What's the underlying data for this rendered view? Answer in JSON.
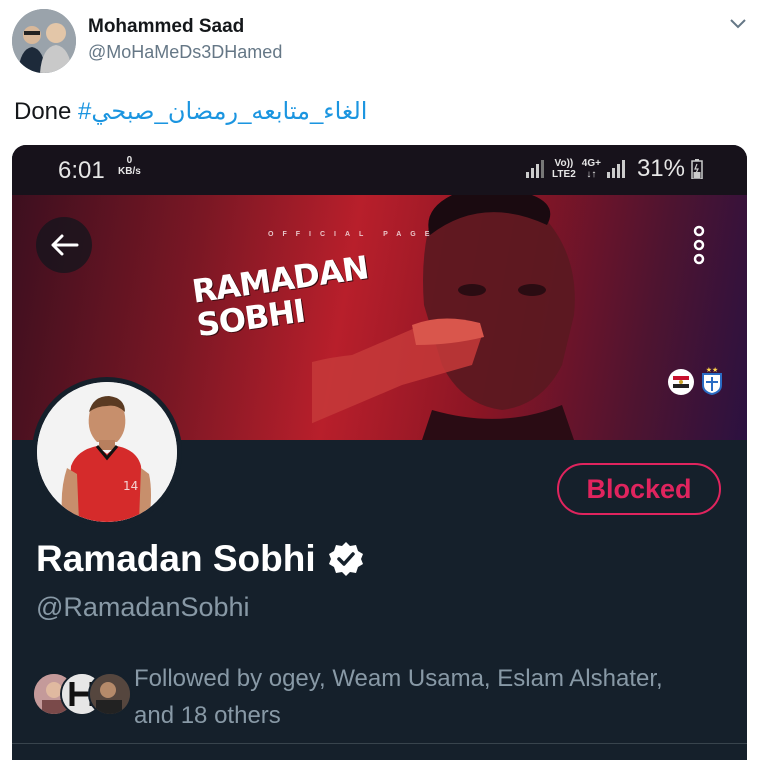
{
  "tweet": {
    "author_name": "Mohammed Saad",
    "author_handle": "@MoHaMeDs3DHamed",
    "text_done": "Done",
    "hashtag": "#الغاء_متابعه_رمضان_صبحي"
  },
  "status_bar": {
    "time": "6:01",
    "speed_value": "0",
    "speed_unit": "KB/s",
    "volte_label": "Vo))",
    "lte_label": "LTE2",
    "net_label": "4G+",
    "battery": "31%"
  },
  "banner": {
    "official_label": "OFFICIAL PAGE",
    "title_line1": "RAMADAN",
    "title_line2": "SOBHI",
    "jersey_number": "14"
  },
  "profile": {
    "name": "Ramadan Sobhi",
    "handle": "@RamadanSobhi",
    "blocked_label": "Blocked",
    "followed_by_line1": "Followed by ogey, Weam Usama, Eslam Alshater,",
    "followed_by_line2": "and 18 others"
  },
  "colors": {
    "hashtag": "#1b95e0",
    "profile_bg": "#15202b",
    "blocked": "#e0245e",
    "secondary_text": "#8899a6"
  }
}
